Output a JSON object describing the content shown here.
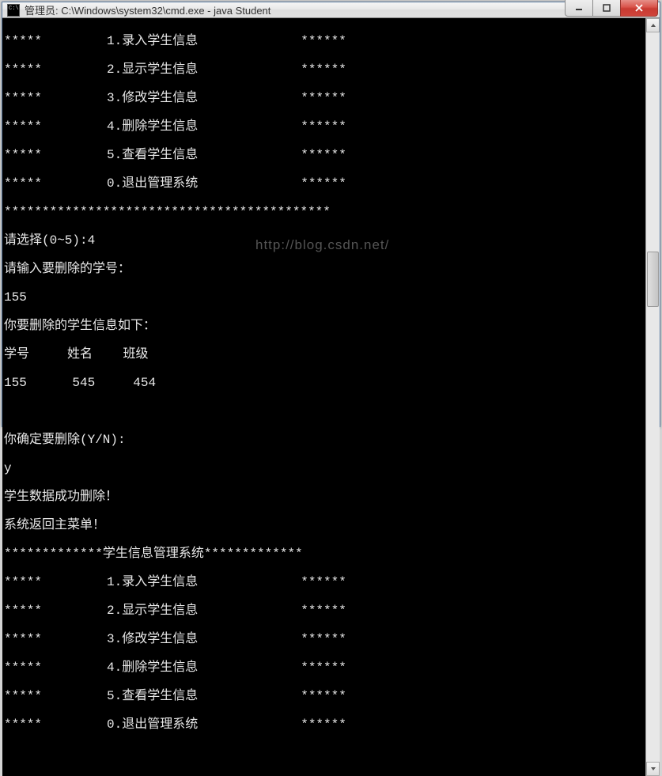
{
  "titlebar": {
    "text": "管理员: C:\\Windows\\system32\\cmd.exe - java  Student"
  },
  "menu": {
    "prefix": "*****",
    "suffix": "******",
    "items": [
      "1.录入学生信息",
      "2.显示学生信息",
      "3.修改学生信息",
      "4.删除学生信息",
      "5.查看学生信息",
      "0.退出管理系统"
    ],
    "separator": "*******************************************",
    "header": "*************学生信息管理系统*************"
  },
  "prompts": {
    "choose": "请选择(0~5):",
    "choice": "4",
    "enter_id": "请输入要删除的学号：",
    "id_value": "155",
    "info_header": "你要删除的学生信息如下：",
    "col_id": "学号",
    "col_name": "姓名",
    "col_class": "班级",
    "row_id": "155",
    "row_name": "545",
    "row_class": "454",
    "confirm": "你确定要删除(Y/N):",
    "confirm_value": "y",
    "deleted": "学生数据成功删除！",
    "return": "系统返回主菜单！"
  },
  "watermark": "http://blog.csdn.net/"
}
